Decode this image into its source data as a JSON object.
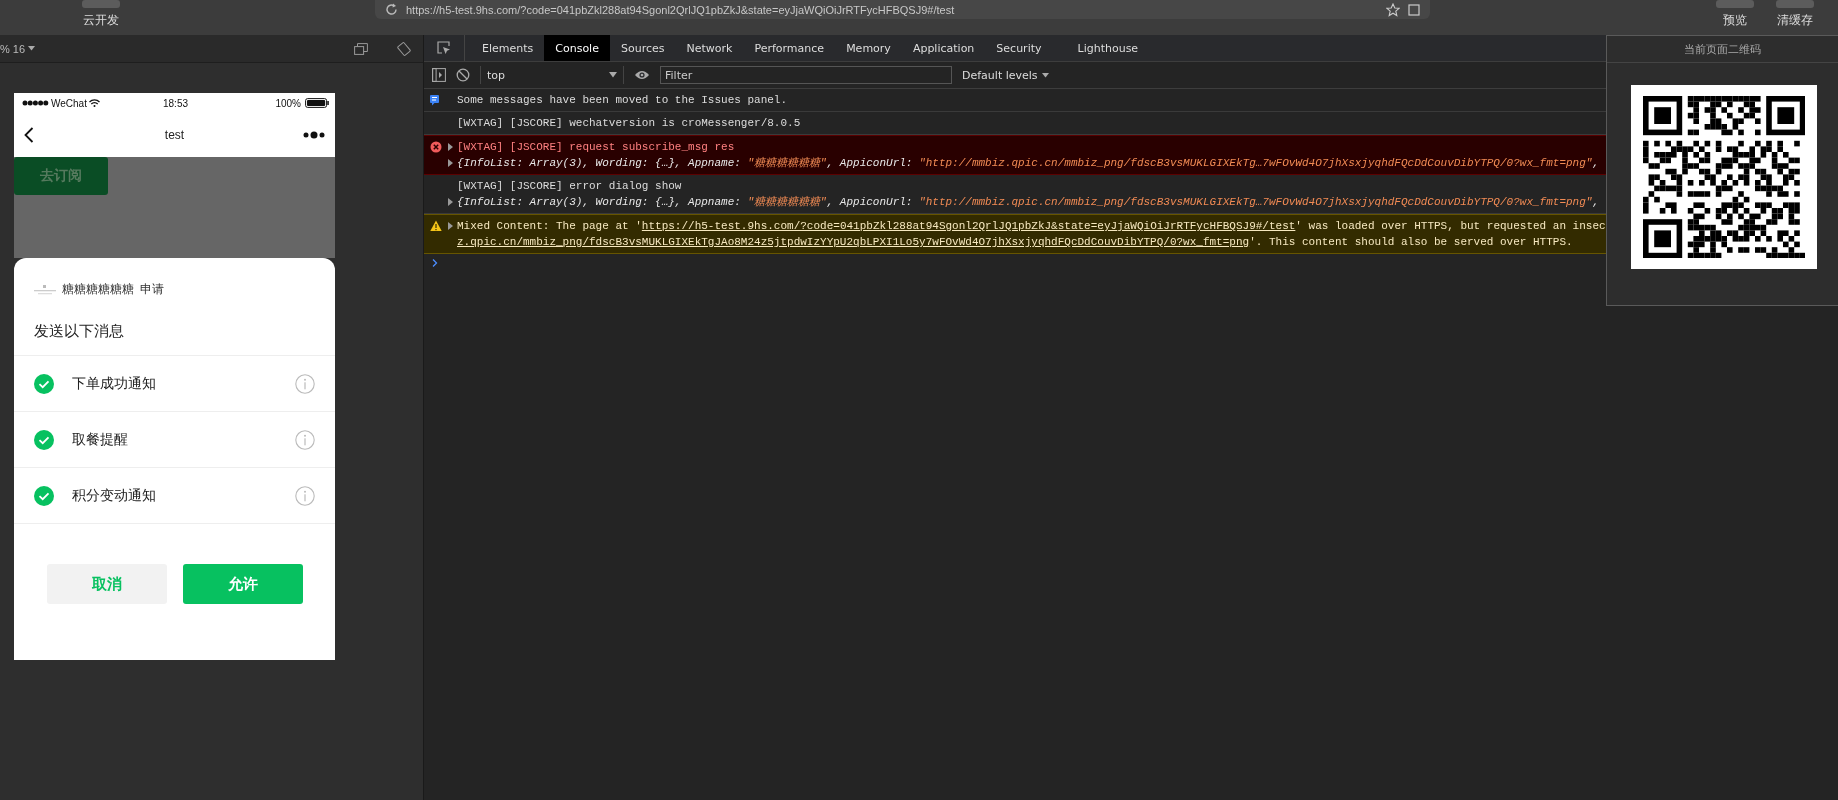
{
  "toolbar": {
    "cloud_label": "云开发",
    "address": "https://h5-test.9hs.com/?code=041pbZkl288at94Sgonl2QrlJQ1pbZkJ&state=eyJjaWQiOiJrRTFycHFBQSJ9#/test",
    "buttons": [
      "预览",
      "清缓存"
    ]
  },
  "simulator": {
    "zoom": "% 16",
    "phone": {
      "carrier": "WeChat",
      "time": "18:53",
      "battery": "100%",
      "nav_title": "test",
      "subscribe_button": "去订阅",
      "sheet": {
        "app_name": "糖糖糖糖糖糖",
        "request_label": "申请",
        "prompt": "发送以下消息",
        "items": [
          {
            "label": "下单成功通知",
            "checked": true
          },
          {
            "label": "取餐提醒",
            "checked": true
          },
          {
            "label": "积分变动通知",
            "checked": true
          }
        ],
        "cancel": "取消",
        "allow": "允许"
      }
    }
  },
  "devtools": {
    "tabs": [
      {
        "label": "Elements",
        "selected": false
      },
      {
        "label": "Console",
        "selected": true
      },
      {
        "label": "Sources",
        "selected": false
      },
      {
        "label": "Network",
        "selected": false
      },
      {
        "label": "Performance",
        "selected": false
      },
      {
        "label": "Memory",
        "selected": false
      },
      {
        "label": "Application",
        "selected": false
      },
      {
        "label": "Security",
        "selected": false
      },
      {
        "label": "Lighthouse",
        "selected": false
      }
    ],
    "context": "top",
    "filter_placeholder": "Filter",
    "levels": "Default levels",
    "messages": [
      {
        "kind": "info",
        "lines": [
          {
            "kind": "text",
            "expandable": false,
            "parts": [
              {
                "kind": "plain",
                "text": "Some messages have been moved to the Issues panel."
              }
            ]
          }
        ]
      },
      {
        "kind": "log",
        "lines": [
          {
            "kind": "text",
            "expandable": false,
            "parts": [
              {
                "kind": "plain",
                "text": "[WXTAG] [JSCORE] wechatversion is croMessenger/8.0.5"
              }
            ]
          }
        ]
      },
      {
        "kind": "error",
        "lines": [
          {
            "kind": "text",
            "expandable": true,
            "parts": [
              {
                "kind": "plain",
                "text": "[WXTAG] [JSCORE] request subscribe_msg res"
              }
            ]
          },
          {
            "kind": "object",
            "expandable": true,
            "parts": [
              {
                "kind": "plain",
                "text": "{InfoList: Array(3), Wording: {…}, Appname: "
              },
              {
                "kind": "string",
                "text": "\"糖糖糖糖糖糖\""
              },
              {
                "kind": "plain",
                "text": ", AppiconUrl: "
              },
              {
                "kind": "string",
                "text": "\"http://mmbiz.qpic.cn/mmbiz_png/fdscB3vsMUKLGIXEkTg…7wFOvWd4O7jhXsxjyqhdFQcDdCouvDibYTPQ/0?wx_fmt=png\""
              },
              {
                "kind": "plain",
                "text": ","
              }
            ]
          }
        ]
      },
      {
        "kind": "log",
        "lines": [
          {
            "kind": "text",
            "expandable": false,
            "parts": [
              {
                "kind": "plain",
                "text": "[WXTAG] [JSCORE] error dialog show"
              }
            ]
          },
          {
            "kind": "object",
            "expandable": true,
            "parts": [
              {
                "kind": "plain",
                "text": "{InfoList: Array(3), Wording: {…}, Appname: "
              },
              {
                "kind": "string",
                "text": "\"糖糖糖糖糖糖\""
              },
              {
                "kind": "plain",
                "text": ", AppiconUrl: "
              },
              {
                "kind": "string",
                "text": "\"http://mmbiz.qpic.cn/mmbiz_png/fdscB3vsMUKLGIXEkTg…7wFOvWd4O7jhXsxjyqhdFQcDdCouvDibYTPQ/0?wx_fmt=png\""
              },
              {
                "kind": "plain",
                "text": ","
              }
            ]
          }
        ]
      },
      {
        "kind": "warning",
        "lines": [
          {
            "kind": "text",
            "expandable": true,
            "parts": [
              {
                "kind": "plain",
                "text": "Mixed Content: The page at '"
              },
              {
                "kind": "link",
                "text": "https://h5-test.9hs.com/?code=041pbZkl288at94Sgonl2QrlJQ1pbZkJ&state=eyJjaWQiOiJrRTFycHFBQSJ9#/test"
              },
              {
                "kind": "plain",
                "text": "' was loaded over HTTPS, but requested an insec"
              }
            ]
          },
          {
            "kind": "text",
            "expandable": false,
            "parts": [
              {
                "kind": "link",
                "text": "z.qpic.cn/mmbiz_png/fdscB3vsMUKLGIXEkTgJAo8M24z5jtpdwIzYYpU2qbLPXI1Lo5y7wFOvWd4O7jhXsxjyqhdFQcDdCouvDibYTPQ/0?wx_fmt=png"
              },
              {
                "kind": "plain",
                "text": "'. This content should also be served over HTTPS."
              }
            ]
          }
        ]
      }
    ]
  },
  "qr_popup": {
    "title": "当前页面二维码"
  }
}
